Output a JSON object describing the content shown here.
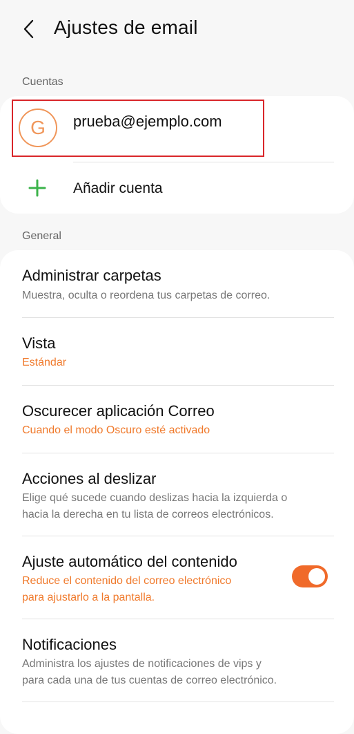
{
  "header": {
    "title": "Ajustes de email",
    "back_icon": "chevron-left-icon"
  },
  "sections": {
    "accounts_label": "Cuentas",
    "general_label": "General"
  },
  "accounts": {
    "email": "prueba@ejemplo.com",
    "avatar_letter": "G",
    "add_label": "Añadir cuenta",
    "add_icon": "plus-icon",
    "accent_color": "#f0965a",
    "plus_color": "#3bb34a"
  },
  "general": {
    "items": [
      {
        "title": "Administrar carpetas",
        "subtitle": "Muestra, oculta o reordena tus carpetas de correo."
      },
      {
        "title": "Vista",
        "subtitle": "Estándar"
      },
      {
        "title": "Oscurecer aplicación Correo",
        "subtitle": "Cuando el modo Oscuro esté activado"
      },
      {
        "title": "Acciones al deslizar",
        "subtitle_line1": "Elige qué sucede cuando deslizas hacia la izquierda o",
        "subtitle_line2": "hacia la derecha en tu lista de correos electrónicos."
      },
      {
        "title": "Ajuste automático del contenido",
        "subtitle_line1": "Reduce el contenido del correo electrónico",
        "subtitle_line2": "para ajustarlo a la pantalla.",
        "toggle_on": true
      },
      {
        "title": "Notificaciones",
        "subtitle_line1": "Administra los ajustes de notificaciones de vips y",
        "subtitle_line2": "para cada una de tus cuentas de correo electrónico."
      }
    ],
    "toggle_color": "#f06a2a",
    "accent_text_color": "#f07a2c"
  }
}
